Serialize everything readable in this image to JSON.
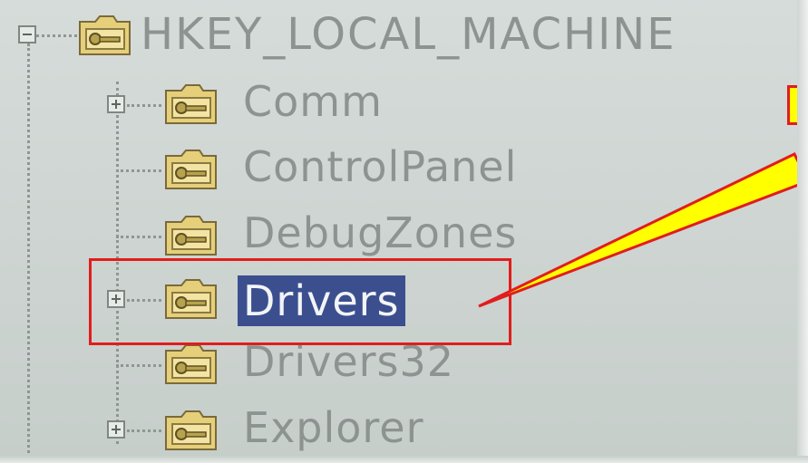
{
  "window": {
    "title": ""
  },
  "tree": {
    "root": {
      "label": "HKEY_LOCAL_MACHINE",
      "expanded": true
    },
    "children": [
      {
        "label": "Comm",
        "expandable": true,
        "selected": false
      },
      {
        "label": "ControlPanel",
        "expandable": false,
        "selected": false
      },
      {
        "label": "DebugZones",
        "expandable": false,
        "selected": false
      },
      {
        "label": "Drivers",
        "expandable": true,
        "selected": true
      },
      {
        "label": "Drivers32",
        "expandable": false,
        "selected": false
      },
      {
        "label": "Explorer",
        "expandable": true,
        "selected": false
      }
    ]
  },
  "annotation": {
    "highlight_color": "#e11d1d",
    "callout_fill": "#ffff00",
    "callout_text": ""
  },
  "colors": {
    "selection": "#3b4f8f",
    "text": "#8d9390",
    "background": "#cfd6d3"
  },
  "icons": {
    "folder": "registry-key-folder-icon",
    "expander_collapsed": "plus-expander-icon",
    "expander_expanded": "minus-expander-icon"
  }
}
